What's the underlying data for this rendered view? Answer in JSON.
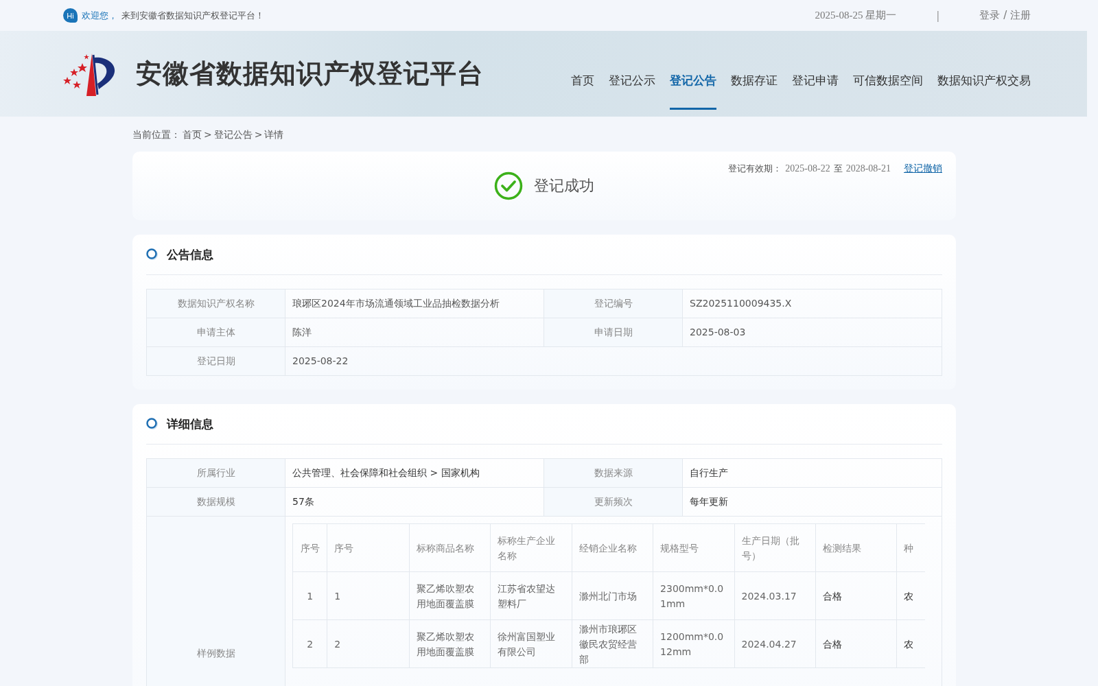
{
  "topbar": {
    "badge": "Hi",
    "welcome_highlight": "欢迎您，",
    "welcome_text": "来到安徽省数据知识产权登记平台！",
    "date": "2025-08-25 星期一",
    "separator": "|",
    "auth": "登录 / 注册"
  },
  "header": {
    "site_title": "安徽省数据知识产权登记平台",
    "nav": [
      {
        "label": "首页",
        "selected": false
      },
      {
        "label": "登记公示",
        "selected": false
      },
      {
        "label": "登记公告",
        "selected": true
      },
      {
        "label": "数据存证",
        "selected": false
      },
      {
        "label": "登记申请",
        "selected": false
      },
      {
        "label": "可信数据空间",
        "selected": false
      },
      {
        "label": "数据知识产权交易",
        "selected": false
      }
    ]
  },
  "breadcrumb": {
    "label": "当前位置：",
    "items": [
      "首页",
      "登记公告",
      "详情"
    ],
    "separator": ">"
  },
  "status": {
    "title": "登记成功",
    "validity_label": "登记有效期：",
    "validity_start": "2025-08-22",
    "validity_to": "至",
    "validity_end": "2028-08-21",
    "revoke_link": "登记撤销"
  },
  "announcement": {
    "title": "公告信息",
    "rows": [
      [
        {
          "label": "数据知识产权名称",
          "value": "琅琊区2024年市场流通领域工业品抽检数据分析"
        },
        {
          "label": "登记编号",
          "value": "SZ2025110009435.X"
        }
      ],
      [
        {
          "label": "申请主体",
          "value": "陈洋"
        },
        {
          "label": "申请日期",
          "value": "2025-08-03"
        }
      ],
      [
        {
          "label": "登记日期",
          "value": "2025-08-22"
        }
      ]
    ]
  },
  "details": {
    "title": "详细信息",
    "rows": [
      [
        {
          "label": "所属行业",
          "value": "公共管理、社会保障和社会组织 > 国家机构"
        },
        {
          "label": "数据来源",
          "value": "自行生产"
        }
      ],
      [
        {
          "label": "数据规模",
          "value": "57条"
        },
        {
          "label": "更新频次",
          "value": "每年更新"
        }
      ]
    ],
    "sample_label": "样例数据",
    "sample_table": {
      "columns": [
        "序号",
        "序号",
        "标称商品名称",
        "标称生产企业名称",
        "经销企业名称",
        "规格型号",
        "生产日期（批号）",
        "检测结果",
        "种"
      ],
      "rows": [
        [
          "1",
          "1",
          "聚乙烯吹塑农用地面覆盖膜",
          "江苏省农望达塑料厂",
          "滁州北门市场",
          "2300mm*0.01mm",
          "2024.03.17",
          "合格",
          "农"
        ],
        [
          "2",
          "2",
          "聚乙烯吹塑农用地面覆盖膜",
          "徐州富国塑业有限公司",
          "滁州市琅琊区徽民农贸经营部",
          "1200mm*0.012mm",
          "2024.04.27",
          "合格",
          "农"
        ]
      ]
    }
  }
}
